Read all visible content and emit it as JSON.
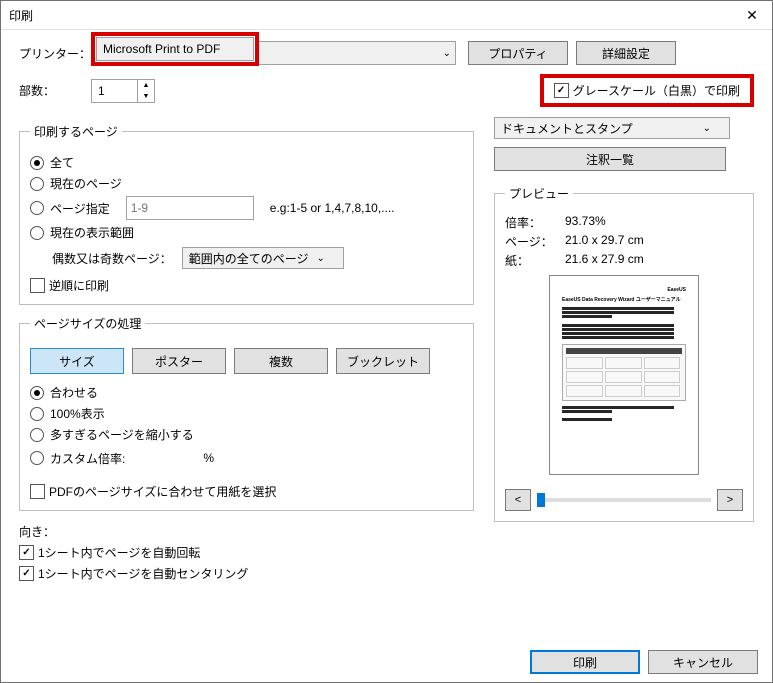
{
  "dialog": {
    "title": "印刷"
  },
  "printer": {
    "label": "プリンター：",
    "selected": "Microsoft Print to PDF",
    "properties_btn": "プロパティ",
    "advanced_btn": "詳細設定"
  },
  "copies": {
    "label": "部数：",
    "value": "1"
  },
  "grayscale": {
    "label": "グレースケール（白黒）で印刷",
    "checked": true
  },
  "range_group": {
    "legend": "印刷するページ",
    "all": "全て",
    "current": "現在のページ",
    "pages": "ページ指定",
    "pages_placeholder": "1-9",
    "pages_example": "e.g:1-5 or 1,4,7,8,10,....",
    "view": "現在の表示範囲",
    "odd_even_label": "偶数又は奇数ページ：",
    "odd_even_selected": "範囲内の全てのページ",
    "reverse": "逆順に印刷"
  },
  "sizing_group": {
    "legend": "ページサイズの処理",
    "tabs": {
      "size": "サイズ",
      "poster": "ポスター",
      "multiple": "複数",
      "booklet": "ブックレット"
    },
    "fit": "合わせる",
    "actual": "100%表示",
    "shrink": "多すぎるページを縮小する",
    "custom": "カスタム倍率:",
    "percent": "%",
    "use_pdf_size": "PDFのページサイズに合わせて用紙を選択"
  },
  "orientation": {
    "label": "向き：",
    "auto_rotate": "1シート内でページを自動回転",
    "auto_center": "1シート内でページを自動センタリング"
  },
  "right": {
    "doc_stamp_selected": "ドキュメントとスタンプ",
    "comments_btn": "注釈一覧",
    "preview_legend": "プレビュー",
    "zoom_label": "倍率：",
    "zoom_value": "93.73%",
    "page_label": "ページ：",
    "page_value": "21.0 x 29.7 cm",
    "paper_label": "紙：",
    "paper_value": "21.6 x 27.9 cm",
    "prev": "<",
    "next": ">",
    "pv_brand": "EaseUS",
    "pv_title": "EaseUS Data Recovery Wizard ユーザーマニュアル"
  },
  "footer": {
    "print": "印刷",
    "cancel": "キャンセル"
  }
}
